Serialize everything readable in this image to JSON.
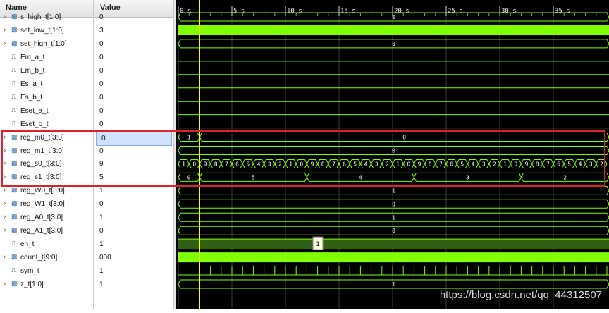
{
  "headers": {
    "name": "Name",
    "value": "Value"
  },
  "colors": {
    "signal": "#7fff00",
    "cursor": "#ffff00",
    "highlight": "#e0202a",
    "selected_row": "#cfe3ff"
  },
  "timeline": {
    "unit": "s",
    "ticks": [
      "0 s",
      "5 s",
      "10 s",
      "15 s",
      "20 s",
      "25 s",
      "30 s",
      "35 s"
    ],
    "cursor_time": 2
  },
  "signals": [
    {
      "name": "s_high_t[1:0]",
      "value": "0",
      "type": "bus",
      "expandable": true
    },
    {
      "name": "set_low_t[1:0]",
      "value": "3",
      "type": "bus",
      "expandable": true
    },
    {
      "name": "set_high_t[1:0]",
      "value": "0",
      "type": "bus",
      "expandable": true
    },
    {
      "name": "Em_a_t",
      "value": "0",
      "type": "bit",
      "expandable": false
    },
    {
      "name": "Em_b_t",
      "value": "0",
      "type": "bit",
      "expandable": false
    },
    {
      "name": "Es_a_t",
      "value": "0",
      "type": "bit",
      "expandable": false
    },
    {
      "name": "Es_b_t",
      "value": "0",
      "type": "bit",
      "expandable": false
    },
    {
      "name": "Eset_a_t",
      "value": "0",
      "type": "bit",
      "expandable": false
    },
    {
      "name": "Eset_b_t",
      "value": "0",
      "type": "bit",
      "expandable": false
    },
    {
      "name": "reg_m0_t[3:0]",
      "value": "0",
      "type": "bus",
      "expandable": true,
      "selected": true
    },
    {
      "name": "reg_m1_t[3:0]",
      "value": "0",
      "type": "bus",
      "expandable": true
    },
    {
      "name": "reg_s0_t[3:0]",
      "value": "9",
      "type": "bus",
      "expandable": true
    },
    {
      "name": "reg_s1_t[3:0]",
      "value": "5",
      "type": "bus",
      "expandable": true
    },
    {
      "name": "reg_W0_t[3:0]",
      "value": "1",
      "type": "bus",
      "expandable": true
    },
    {
      "name": "reg_W1_t[3:0]",
      "value": "0",
      "type": "bus",
      "expandable": true
    },
    {
      "name": "reg_A0_t[3:0]",
      "value": "1",
      "type": "bus",
      "expandable": true
    },
    {
      "name": "reg_A1_t[3:0]",
      "value": "0",
      "type": "bus",
      "expandable": true
    },
    {
      "name": "en_t",
      "value": "1",
      "type": "bit",
      "expandable": false
    },
    {
      "name": "count_t[9:0]",
      "value": "000",
      "type": "bus",
      "expandable": true
    },
    {
      "name": "sym_t",
      "value": "1",
      "type": "bit",
      "expandable": false
    },
    {
      "name": "z_t[1:0]",
      "value": "1",
      "type": "bus",
      "expandable": true
    }
  ],
  "waveform_labels": {
    "s_high": "0",
    "set_high": "0",
    "reg_m0_first": "1",
    "reg_m0_rest": "0",
    "reg_m1": "0",
    "reg_s0_sequence": [
      "1",
      "0",
      "9",
      "8",
      "7",
      "6",
      "5",
      "4",
      "3",
      "2",
      "1",
      "0",
      "9",
      "8",
      "7",
      "6",
      "5",
      "4",
      "3",
      "2",
      "1",
      "0",
      "9",
      "8",
      "7",
      "6",
      "5",
      "4",
      "3",
      "2",
      "1",
      "0",
      "9",
      "8",
      "7",
      "6",
      "5",
      "4",
      "3",
      "2"
    ],
    "reg_s1_sequence": [
      "0",
      "5",
      "4",
      "3",
      "2"
    ],
    "reg_W0": "1",
    "reg_W1": "0",
    "reg_A0": "1",
    "reg_A1": "0",
    "en_tooltip": "1",
    "z": "1"
  },
  "watermark": "https://blog.csdn.net/qq_44312507"
}
